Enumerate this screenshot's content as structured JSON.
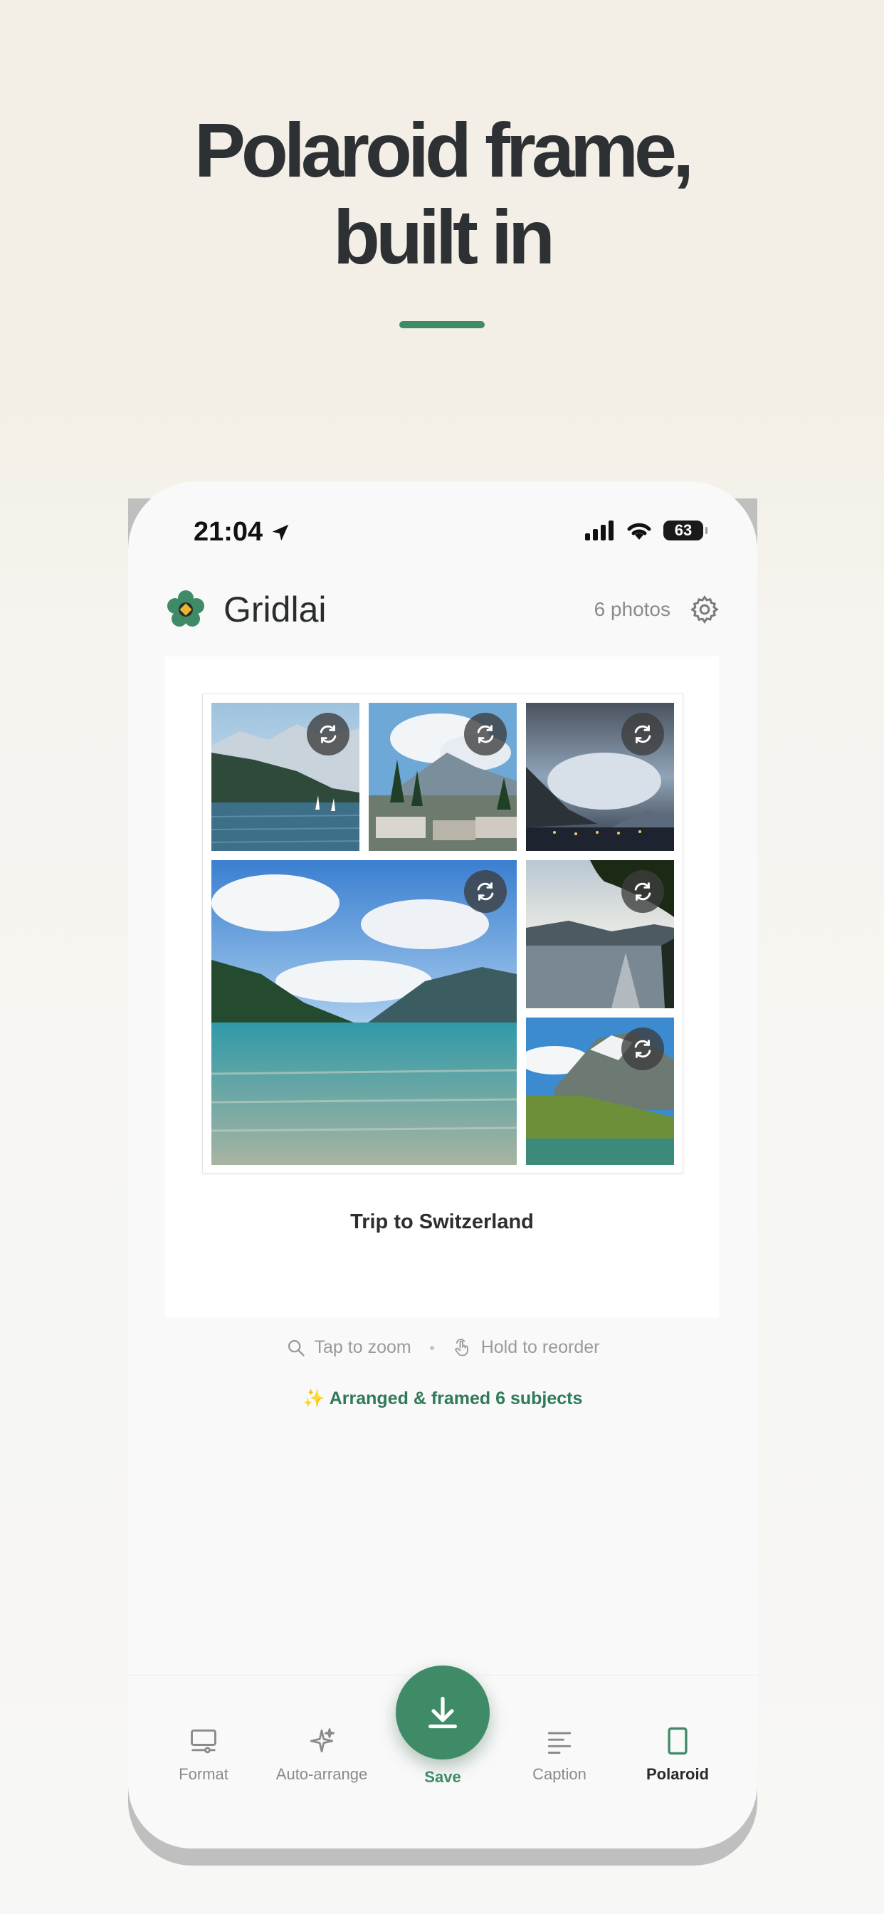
{
  "hero": {
    "headline_line1": "Polaroid frame,",
    "headline_line2": "built in",
    "accent_color": "#3f8b68"
  },
  "status_bar": {
    "time": "21:04",
    "battery": "63",
    "icons": [
      "location-arrow-icon",
      "cellular-signal-icon",
      "wifi-icon",
      "battery-icon"
    ]
  },
  "app_header": {
    "logo": "flower-logo",
    "title": "Gridlai",
    "photo_count": "6 photos",
    "settings_icon": "gear-icon"
  },
  "collage": {
    "caption": "Trip to Switzerland",
    "photos": [
      {
        "subject": "lake with mountains and sailboats",
        "swap_icon": "swap-icon"
      },
      {
        "subject": "mountain village with trees",
        "swap_icon": "swap-icon"
      },
      {
        "subject": "dramatic clouds over lake town",
        "swap_icon": "swap-icon"
      },
      {
        "subject": "clear turquoise lake with clouds",
        "swap_icon": "swap-icon"
      },
      {
        "subject": "lake at sunset under tree",
        "swap_icon": "swap-icon"
      },
      {
        "subject": "alpine lake with snowy peaks",
        "swap_icon": "swap-icon"
      }
    ]
  },
  "hints": {
    "zoom": "Tap to zoom",
    "reorder": "Hold to reorder"
  },
  "status_message": "✨ Arranged & framed 6 subjects",
  "tabbar": {
    "format": "Format",
    "auto_arrange": "Auto-arrange",
    "save": "Save",
    "caption": "Caption",
    "polaroid": "Polaroid",
    "active_tab": "Polaroid"
  }
}
